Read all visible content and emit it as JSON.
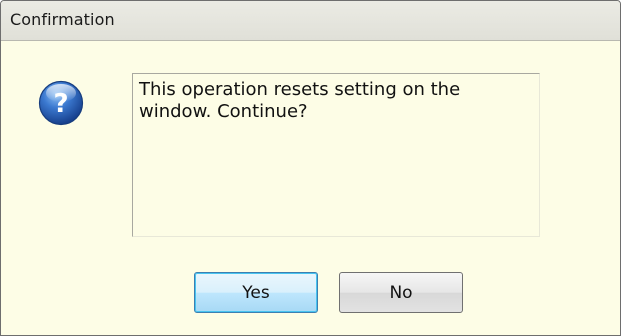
{
  "dialog": {
    "title": "Confirmation",
    "icon": "question-icon",
    "message": "This operation resets setting on the\nwindow. Continue?",
    "buttons": {
      "yes_label": "Yes",
      "no_label": "No"
    }
  },
  "colors": {
    "background": "#fdfde6",
    "titlebar": "#e5e5dd",
    "icon_blue": "#2a5fb0",
    "default_button_border": "#3c7fb1"
  }
}
